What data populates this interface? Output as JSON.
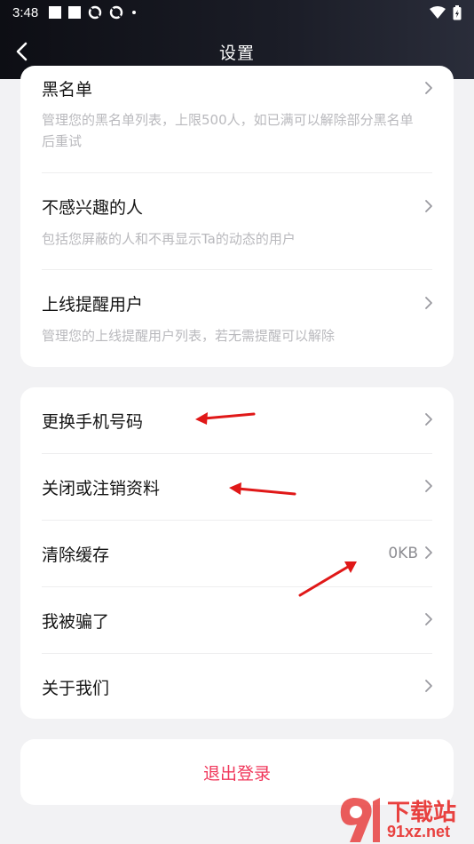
{
  "status_bar": {
    "time": "3:48"
  },
  "header": {
    "title": "设置"
  },
  "card_privacy": {
    "items": [
      {
        "label": "黑名单",
        "desc": "管理您的黑名单列表，上限500人，如已满可以解除部分黑名单后重试"
      },
      {
        "label": "不感兴趣的人",
        "desc": "包括您屏蔽的人和不再显示Ta的动态的用户"
      },
      {
        "label": "上线提醒用户",
        "desc": "管理您的上线提醒用户列表，若无需提醒可以解除"
      }
    ]
  },
  "card_account": {
    "items": [
      {
        "label": "更换手机号码"
      },
      {
        "label": "关闭或注销资料"
      },
      {
        "label": "清除缓存",
        "value": "0KB"
      },
      {
        "label": "我被骗了"
      },
      {
        "label": "关于我们"
      }
    ]
  },
  "logout": {
    "label": "退出登录"
  },
  "watermark": {
    "brand": "下载站",
    "domain": "91xz.net"
  },
  "colors": {
    "accent": "#f0365a",
    "annotation": "#e01818"
  }
}
